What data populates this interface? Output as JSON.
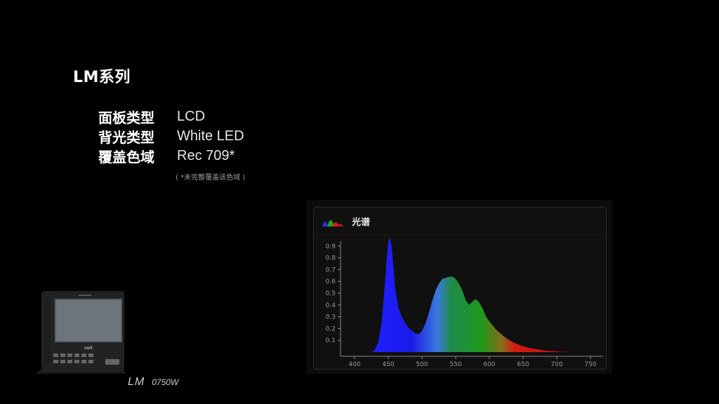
{
  "series_title": "LM系列",
  "specs": [
    {
      "key": "面板类型",
      "value": "LCD"
    },
    {
      "key": "背光类型",
      "value": "White LED"
    },
    {
      "key": "覆盖色域",
      "value": "Rec 709*"
    }
  ],
  "footnote": "( *未完整覆盖该色域 )",
  "spectrum_panel": {
    "title": "光谱",
    "icon": "spectrum-icon"
  },
  "chart_data": {
    "type": "area",
    "title": "光谱",
    "xlabel": "",
    "ylabel": "",
    "xlim": [
      400,
      750
    ],
    "ylim": [
      0,
      1.0
    ],
    "x_ticks": [
      "400",
      "450",
      "500",
      "550",
      "600",
      "650",
      "700",
      "750"
    ],
    "y_ticks": [
      "0.1",
      "0.2",
      "0.3",
      "0.4",
      "0.5",
      "0.6",
      "0.7",
      "0.8",
      "0.9"
    ],
    "grid": false,
    "series": [
      {
        "x": [
          425,
          430,
          435,
          440,
          445,
          448,
          450,
          452,
          455,
          458,
          460,
          465,
          470,
          475,
          480,
          485,
          490,
          495,
          500,
          505,
          510,
          515,
          520,
          525,
          530,
          535,
          540,
          545,
          550,
          555,
          560,
          565,
          570,
          575,
          580,
          585,
          590,
          595,
          600,
          610,
          620,
          630,
          640,
          650,
          660,
          670,
          680,
          690,
          700,
          710,
          720
        ],
        "y": [
          0.0,
          0.02,
          0.08,
          0.25,
          0.58,
          0.82,
          0.94,
          0.97,
          0.9,
          0.7,
          0.55,
          0.38,
          0.3,
          0.25,
          0.21,
          0.18,
          0.16,
          0.15,
          0.18,
          0.24,
          0.33,
          0.43,
          0.52,
          0.58,
          0.62,
          0.63,
          0.64,
          0.64,
          0.62,
          0.58,
          0.52,
          0.44,
          0.4,
          0.43,
          0.45,
          0.42,
          0.37,
          0.3,
          0.26,
          0.19,
          0.14,
          0.1,
          0.07,
          0.05,
          0.035,
          0.025,
          0.015,
          0.01,
          0.006,
          0.003,
          0.0
        ]
      }
    ]
  },
  "product": {
    "model_prefix": "LM",
    "model_number": "0750W",
    "monitor_brand": "swit"
  },
  "colors": {
    "background": "#000000",
    "blue": "#1a1aff",
    "green": "#1f9a1f",
    "red": "#e01818"
  }
}
